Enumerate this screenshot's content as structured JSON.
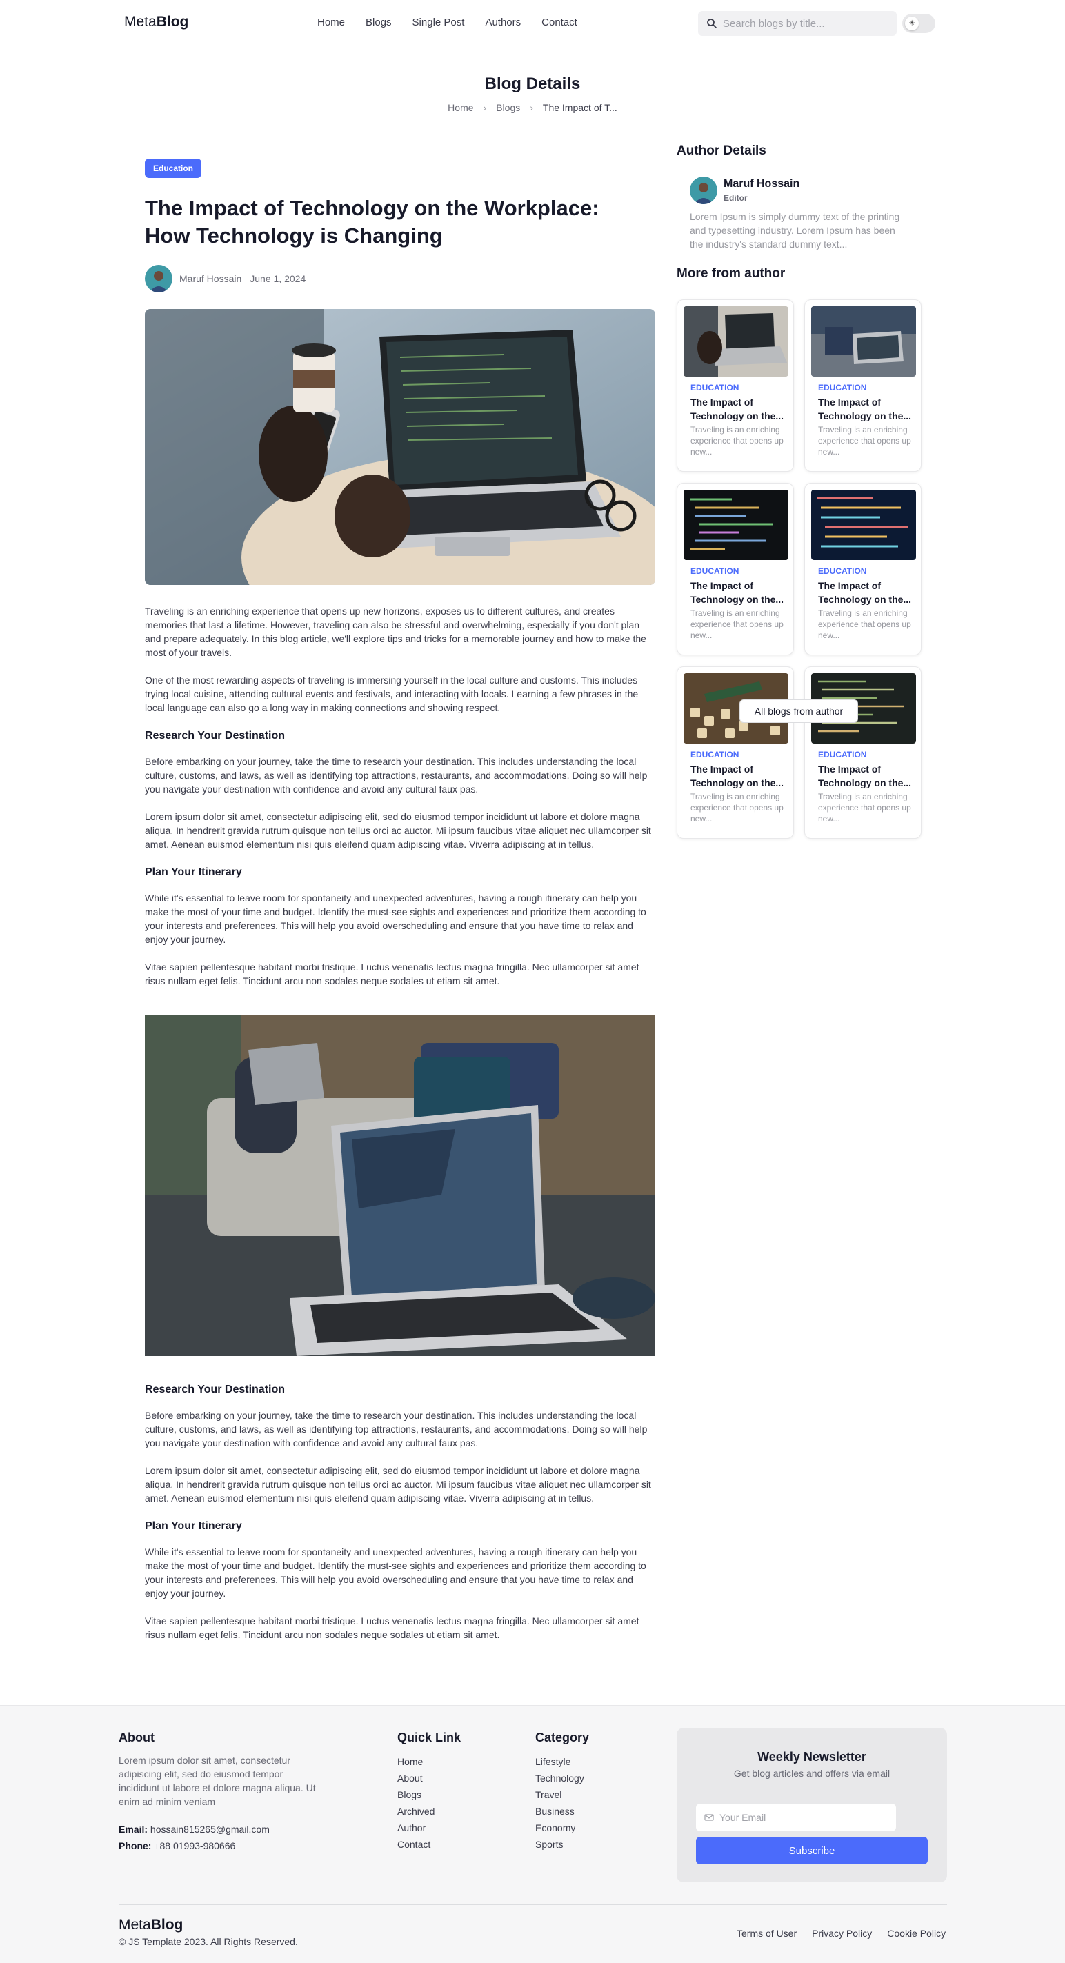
{
  "nav": {
    "logo_light": "Meta",
    "logo_bold": "Blog",
    "links": [
      "Home",
      "Blogs",
      "Single Post",
      "Authors",
      "Contact"
    ],
    "search_placeholder": "Search blogs by title...",
    "toggle_icon": "sun-icon"
  },
  "header": {
    "title": "Blog Details",
    "breadcrumb": [
      "Home",
      "Blogs",
      "The Impact of T..."
    ]
  },
  "article": {
    "category": "Education",
    "title": "The Impact of Technology on the Workplace: How Technology is Changing",
    "author": "Maruf Hossain",
    "date": "June 1, 2024",
    "p1": "Traveling is an enriching experience that opens up new horizons, exposes us to different cultures, and creates memories that last a lifetime. However, traveling can also be stressful and overwhelming, especially if you don't plan and prepare adequately. In this blog article, we'll explore tips and tricks for a memorable journey and how to make the most of your travels.",
    "p2": "One of the most rewarding aspects of traveling is immersing yourself in the local culture and customs. This includes trying local cuisine, attending cultural events and festivals, and interacting with locals. Learning a few phrases in the local language can also go a long way in making connections and showing respect.",
    "h_research": "Research Your Destination",
    "p_research": "Before embarking on your journey, take the time to research your destination. This includes understanding the local culture, customs, and laws, as well as identifying top attractions, restaurants, and accommodations. Doing so will help you navigate your destination with confidence and avoid any cultural faux pas.",
    "p_lorem": "Lorem ipsum dolor sit amet, consectetur adipiscing elit, sed do eiusmod tempor incididunt ut labore et dolore magna aliqua. In hendrerit gravida rutrum quisque non tellus orci ac auctor. Mi ipsum faucibus vitae aliquet nec ullamcorper sit amet. Aenean euismod elementum nisi quis eleifend quam adipiscing vitae. Viverra adipiscing at in tellus.",
    "h_plan": "Plan Your Itinerary",
    "p_plan": "While it's essential to leave room for spontaneity and unexpected adventures, having a rough itinerary can help you make the most of your time and budget. Identify the must-see sights and experiences and prioritize them according to your interests and preferences. This will help you avoid overscheduling and ensure that you have time to relax and enjoy your journey.",
    "p_vitae": "Vitae sapien pellentesque habitant morbi tristique. Luctus venenatis lectus magna fringilla. Nec ullamcorper sit amet risus nullam eget felis. Tincidunt arcu non sodales neque sodales ut etiam sit amet."
  },
  "sidebar": {
    "author_heading": "Author Details",
    "author_name": "Maruf Hossain",
    "author_role": "Editor",
    "author_bio": "Lorem Ipsum is simply dummy text of the printing and typesetting industry. Lorem Ipsum has been the industry's standard dummy text...",
    "more_heading": "More from author",
    "cards": [
      {
        "cat": "EDUCATION",
        "title": "The Impact of Technology on the...",
        "desc": "Traveling is an enriching experience that opens up new..."
      },
      {
        "cat": "EDUCATION",
        "title": "The Impact of Technology on the...",
        "desc": "Traveling is an enriching experience that opens up new..."
      },
      {
        "cat": "EDUCATION",
        "title": "The Impact of Technology on the...",
        "desc": "Traveling is an enriching experience that opens up new..."
      },
      {
        "cat": "EDUCATION",
        "title": "The Impact of Technology on the...",
        "desc": "Traveling is an enriching experience that opens up new..."
      },
      {
        "cat": "EDUCATION",
        "title": "The Impact of Technology on the...",
        "desc": "Traveling is an enriching experience that opens up new..."
      },
      {
        "cat": "EDUCATION",
        "title": "The Impact of Technology on the...",
        "desc": "Traveling is an enriching experience that opens up new..."
      }
    ],
    "all_button": "All blogs from author"
  },
  "footer": {
    "about_heading": "About",
    "about_text": "Lorem ipsum dolor sit amet, consectetur adipiscing elit, sed do eiusmod tempor incididunt ut labore et dolore magna aliqua. Ut enim ad minim veniam",
    "email_label": "Email:",
    "email_value": "hossain815265@gmail.com",
    "phone_label": "Phone:",
    "phone_value": "+88 01993-980666",
    "quick_heading": "Quick Link",
    "quick_links": [
      "Home",
      "About",
      "Blogs",
      "Archived",
      "Author",
      "Contact"
    ],
    "category_heading": "Category",
    "categories": [
      "Lifestyle",
      "Technology",
      "Travel",
      "Business",
      "Economy",
      "Sports"
    ],
    "newsletter_title": "Weekly Newsletter",
    "newsletter_sub": "Get blog articles and offers via email",
    "email_placeholder": "Your Email",
    "subscribe_label": "Subscribe",
    "logo_light": "Meta",
    "logo_bold": "Blog",
    "copyright": "© JS Template 2023. All Rights Reserved.",
    "legal": [
      "Terms of User",
      "Privacy Policy",
      "Cookie Policy"
    ]
  },
  "colors": {
    "accent": "#4b6bfb",
    "text": "#181a2a",
    "muted": "#696a75"
  }
}
